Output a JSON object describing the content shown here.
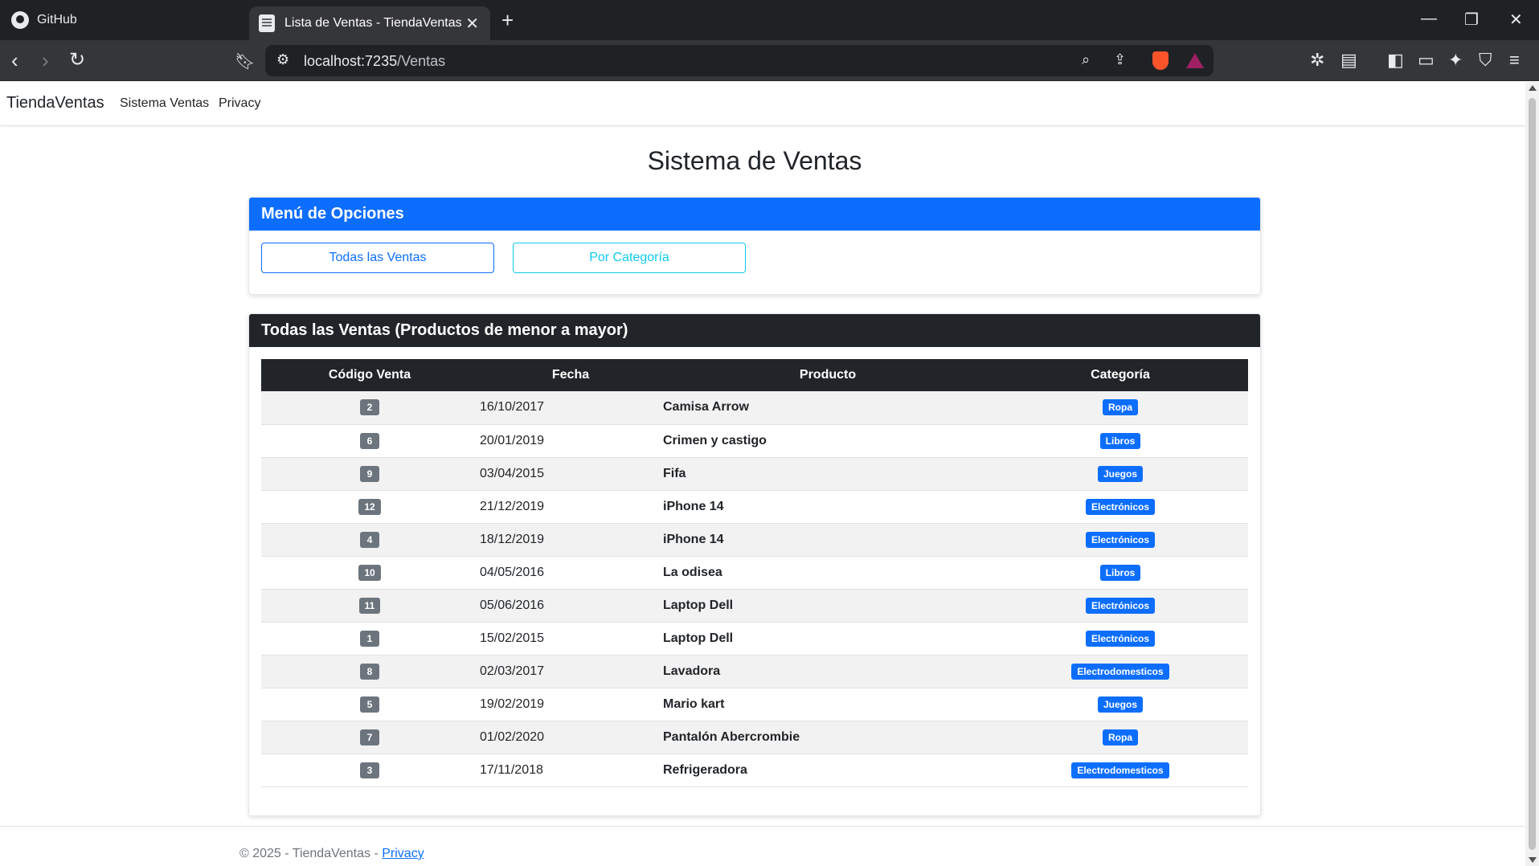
{
  "browser": {
    "tabs": [
      {
        "label": "GitHub",
        "active": false
      },
      {
        "label": "Lista de Ventas - TiendaVentas",
        "active": true
      }
    ],
    "url_host": "localhost:7235",
    "url_path": "/Ventas"
  },
  "nav": {
    "brand": "TiendaVentas",
    "links": [
      "Sistema Ventas",
      "Privacy"
    ]
  },
  "page_title": "Sistema de Ventas",
  "menu_card": {
    "header": "Menú de Opciones",
    "buttons": [
      "Todas las Ventas",
      "Por Categoría"
    ]
  },
  "sales_card": {
    "header": "Todas las Ventas (Productos de menor a mayor)",
    "columns": [
      "Código Venta",
      "Fecha",
      "Producto",
      "Categoría"
    ],
    "rows": [
      {
        "code": "2",
        "date": "16/10/2017",
        "product": "Camisa Arrow",
        "category": "Ropa"
      },
      {
        "code": "6",
        "date": "20/01/2019",
        "product": "Crimen y castigo",
        "category": "Libros"
      },
      {
        "code": "9",
        "date": "03/04/2015",
        "product": "Fifa",
        "category": "Juegos"
      },
      {
        "code": "12",
        "date": "21/12/2019",
        "product": "iPhone 14",
        "category": "Electrónicos"
      },
      {
        "code": "4",
        "date": "18/12/2019",
        "product": "iPhone 14",
        "category": "Electrónicos"
      },
      {
        "code": "10",
        "date": "04/05/2016",
        "product": "La odisea",
        "category": "Libros"
      },
      {
        "code": "11",
        "date": "05/06/2016",
        "product": "Laptop Dell",
        "category": "Electrónicos"
      },
      {
        "code": "1",
        "date": "15/02/2015",
        "product": "Laptop Dell",
        "category": "Electrónicos"
      },
      {
        "code": "8",
        "date": "02/03/2017",
        "product": "Lavadora",
        "category": "Electrodomesticos"
      },
      {
        "code": "5",
        "date": "19/02/2019",
        "product": "Mario kart",
        "category": "Juegos"
      },
      {
        "code": "7",
        "date": "01/02/2020",
        "product": "Pantalón Abercrombie",
        "category": "Ropa"
      },
      {
        "code": "3",
        "date": "17/11/2018",
        "product": "Refrigeradora",
        "category": "Electrodomesticos"
      }
    ]
  },
  "footer": {
    "text": "© 2025 - TiendaVentas - ",
    "link": "Privacy"
  },
  "colors": {
    "primary": "#0d6efd",
    "info": "#0dcaf0",
    "dark": "#212529",
    "secondary_badge": "#6c757d"
  }
}
